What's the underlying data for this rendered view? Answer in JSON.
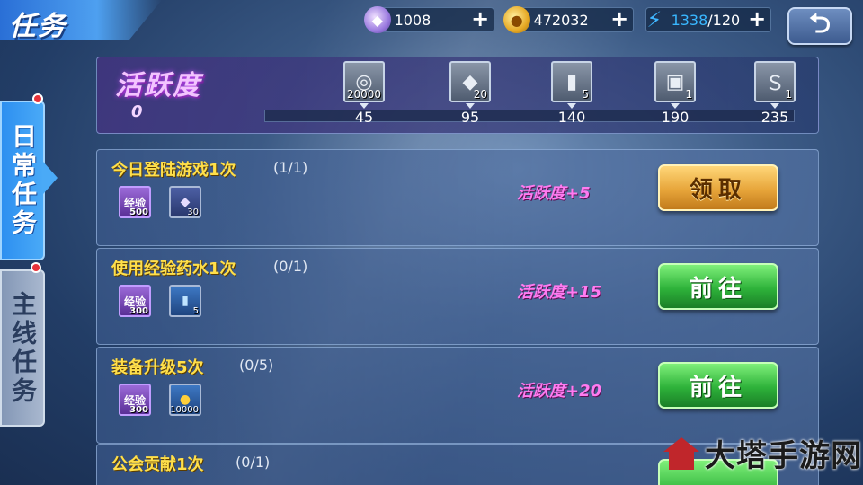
{
  "header": {
    "title": "任务",
    "resources": [
      {
        "name": "gem",
        "icon": "gem-icon",
        "value": "1008"
      },
      {
        "name": "gold",
        "icon": "coin-icon",
        "value": "472032"
      },
      {
        "name": "energy",
        "icon": "bolt-icon",
        "current": "1338",
        "max": "/120"
      }
    ],
    "plus_symbol": "+",
    "back_glyph": "⮌"
  },
  "tabs": [
    {
      "label": "日常任务",
      "active": true,
      "badge": true
    },
    {
      "label": "主线任务",
      "active": false,
      "badge": true
    }
  ],
  "activity": {
    "title": "活跃度",
    "value": "0",
    "progress": 0,
    "milestones": [
      {
        "threshold": "45",
        "qty": "20000",
        "icon": "silver-coins-icon",
        "glyph": "◎"
      },
      {
        "threshold": "95",
        "qty": "20",
        "icon": "crystal-pile-icon",
        "glyph": "◆"
      },
      {
        "threshold": "140",
        "qty": "5",
        "icon": "potion-tube-icon",
        "glyph": "▮"
      },
      {
        "threshold": "190",
        "qty": "1",
        "icon": "treasure-chest-icon",
        "glyph": "▣"
      },
      {
        "threshold": "235",
        "qty": "1",
        "icon": "emblem-icon",
        "glyph": "Ｓ"
      }
    ]
  },
  "tasks": [
    {
      "name": "今日登陆游戏1次",
      "progress": "(1/1)",
      "reward_points": "活跃度+5",
      "rewards": [
        {
          "type": "exp",
          "icon": "exp-icon",
          "label": "经验",
          "qty": "500"
        },
        {
          "type": "gem",
          "icon": "crystal-icon",
          "label": "◆",
          "qty": "30"
        }
      ],
      "button": "领取",
      "button_style": "claim"
    },
    {
      "name": "使用经验药水1次",
      "progress": "(0/1)",
      "reward_points": "活跃度+15",
      "rewards": [
        {
          "type": "exp",
          "icon": "exp-icon",
          "label": "经验",
          "qty": "300"
        },
        {
          "type": "potion",
          "icon": "potion-icon",
          "label": "▮",
          "qty": "5"
        }
      ],
      "button": "前往",
      "button_style": "go"
    },
    {
      "name": "装备升级5次",
      "progress": "(0/5)",
      "reward_points": "活跃度+20",
      "rewards": [
        {
          "type": "exp",
          "icon": "exp-icon",
          "label": "经验",
          "qty": "300"
        },
        {
          "type": "gold",
          "icon": "gold-stack-icon",
          "label": "●",
          "qty": "10000"
        }
      ],
      "button": "前往",
      "button_style": "go"
    },
    {
      "name": "公会贡献1次",
      "progress": "(0/1)"
    }
  ],
  "watermark": {
    "text": "大塔手游网"
  },
  "colors": {
    "task_name": "#ffdf4a",
    "activity_points": "#ff7bf0",
    "claim": "#e7a53a",
    "go": "#2eb23a"
  }
}
